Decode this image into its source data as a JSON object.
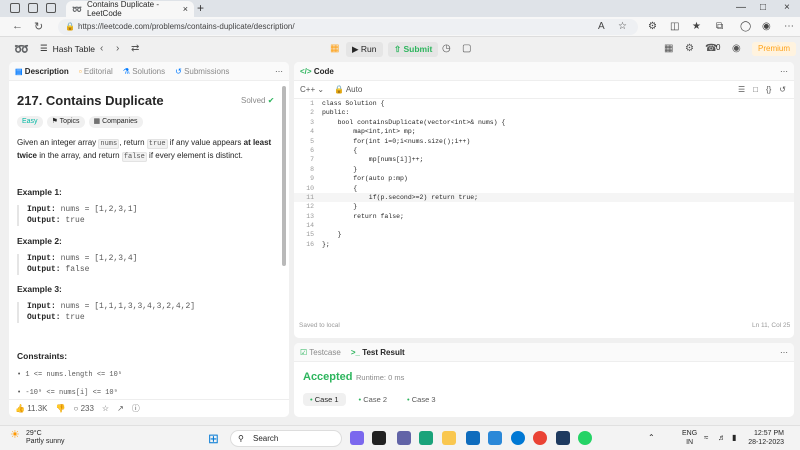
{
  "browser": {
    "tab_title": "Contains Duplicate - LeetCode",
    "url": "https://leetcode.com/problems/contains-duplicate/description/"
  },
  "lc_nav": {
    "problem_list": "Hash Table",
    "run_label": "Run",
    "submit_label": "Submit",
    "coins": "0",
    "premium_label": "Premium"
  },
  "left_panel": {
    "tabs": [
      "Description",
      "Editorial",
      "Solutions",
      "Submissions"
    ],
    "title": "217. Contains Duplicate",
    "solved_label": "Solved",
    "tags": [
      "Easy",
      "Topics",
      "Companies"
    ],
    "description": {
      "p1": "Given an integer array ",
      "c1": "nums",
      "p2": ", return ",
      "c2": "true",
      "p3": " if any value appears ",
      "bold": "at least twice",
      "p4": " in the array, and return ",
      "c3": "false",
      "p5": " if every element is distinct."
    },
    "examples": [
      {
        "heading": "Example 1:",
        "input_label": "Input:",
        "input": "nums = [1,2,3,1]",
        "output_label": "Output:",
        "output": "true"
      },
      {
        "heading": "Example 2:",
        "input_label": "Input:",
        "input": "nums = [1,2,3,4]",
        "output_label": "Output:",
        "output": "false"
      },
      {
        "heading": "Example 3:",
        "input_label": "Input:",
        "input": "nums = [1,1,1,3,3,4,3,2,4,2]",
        "output_label": "Output:",
        "output": "true"
      }
    ],
    "constraints_heading": "Constraints:",
    "constraints": [
      "1 <= nums.length <= 10⁵",
      "-10⁹ <= nums[i] <= 10⁹"
    ],
    "likes": "11.3K",
    "comments": "233"
  },
  "editor": {
    "tab_label": "Code",
    "language": "C++",
    "mode": "Auto",
    "lines": [
      "class Solution {",
      "public:",
      "    bool containsDuplicate(vector<int>& nums) {",
      "        map<int,int> mp;",
      "        for(int i=0;i<nums.size();i++)",
      "        {",
      "            mp[nums[i]]++;",
      "        }",
      "        for(auto p:mp)",
      "        {",
      "            if(p.second>=2) return true;",
      "        }",
      "        return false;",
      "",
      "    }",
      "};"
    ],
    "saved_label": "Saved to local",
    "cursor_pos": "Ln 11, Col 25"
  },
  "result": {
    "tabs": [
      "Testcase",
      "Test Result"
    ],
    "status": "Accepted",
    "runtime": "Runtime: 0 ms",
    "cases": [
      "Case 1",
      "Case 2",
      "Case 3"
    ]
  },
  "taskbar": {
    "temp": "29°C",
    "weather": "Partly sunny",
    "search_label": "Search",
    "lang1": "ENG",
    "lang2": "IN",
    "time": "12:57 PM",
    "date": "28-12-2023"
  },
  "colors": {
    "accent": "#ffa116",
    "accepted": "#2db55d",
    "easy": "#00b8a3"
  }
}
